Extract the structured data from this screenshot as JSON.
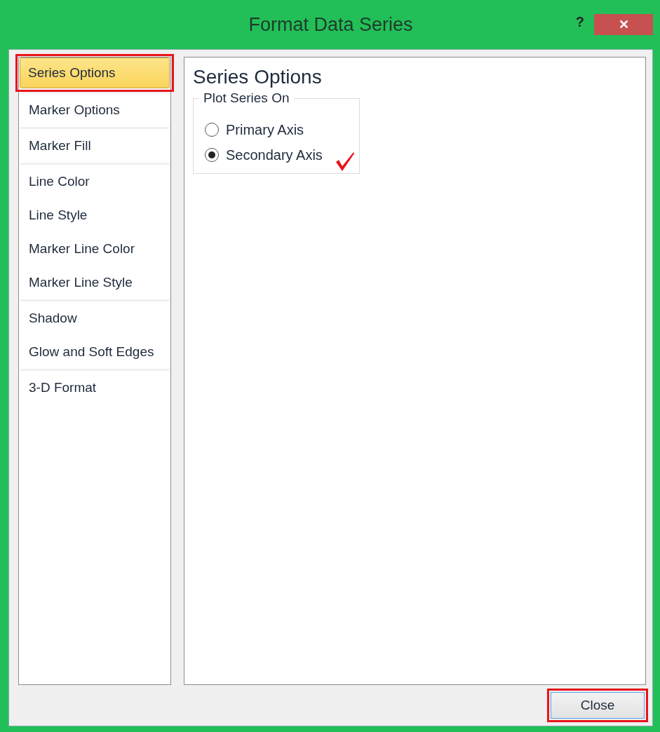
{
  "window": {
    "title": "Format Data Series",
    "help": "?",
    "close": "✕"
  },
  "sidebar": {
    "groups": [
      [
        {
          "label": "Series Options",
          "selected": true,
          "annotated": true
        }
      ],
      [
        {
          "label": "Marker Options",
          "selected": false,
          "annotated": false
        }
      ],
      [
        {
          "label": "Marker Fill",
          "selected": false,
          "annotated": false
        }
      ],
      [
        {
          "label": "Line Color",
          "selected": false,
          "annotated": false
        },
        {
          "label": "Line Style",
          "selected": false,
          "annotated": false
        },
        {
          "label": "Marker Line Color",
          "selected": false,
          "annotated": false
        },
        {
          "label": "Marker Line Style",
          "selected": false,
          "annotated": false
        }
      ],
      [
        {
          "label": "Shadow",
          "selected": false,
          "annotated": false
        },
        {
          "label": "Glow and Soft Edges",
          "selected": false,
          "annotated": false
        }
      ],
      [
        {
          "label": "3-D Format",
          "selected": false,
          "annotated": false
        }
      ]
    ]
  },
  "panel": {
    "heading": "Series Options",
    "group": {
      "legend": "Plot Series On",
      "options": [
        {
          "label": "Primary Axis",
          "selected": false,
          "annotated": false
        },
        {
          "label": "Secondary Axis",
          "selected": true,
          "annotated": true
        }
      ]
    }
  },
  "footer": {
    "button": {
      "label": "Close",
      "annotated": true
    }
  }
}
